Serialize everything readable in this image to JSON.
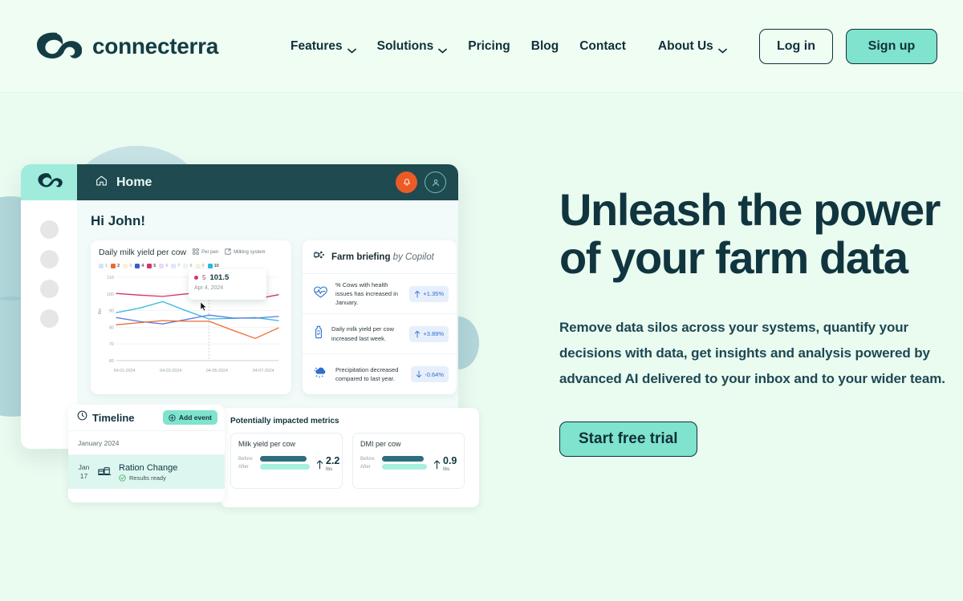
{
  "navbar": {
    "brand": "connecterra",
    "logo_icon": "connecterra-cloud-logo",
    "links": [
      {
        "label": "Features",
        "has_chevron": true
      },
      {
        "label": "Solutions",
        "has_chevron": true
      },
      {
        "label": "Pricing",
        "has_chevron": false
      },
      {
        "label": "Blog",
        "has_chevron": false
      },
      {
        "label": "Contact",
        "has_chevron": false
      },
      {
        "label": "About Us",
        "has_chevron": true
      }
    ],
    "login_label": "Log in",
    "signup_label": "Sign up"
  },
  "hero": {
    "heading_line1": "Unleash the power",
    "heading_line2": "of your farm data",
    "body": "Remove data silos across your systems, quantify your decisions with data, get insights and analysis powered by advanced AI delivered to your inbox and to your wider team.",
    "cta_label": "Start free trial"
  },
  "app": {
    "logo_icon": "connecterra-mark",
    "home_label": "Home",
    "home_icon": "home-icon",
    "bell_icon": "bell-icon",
    "avatar_icon": "user-avatar-icon",
    "greeting": "Hi John!",
    "sidebar_dots": 4
  },
  "chart_card": {
    "title": "Daily milk yield per cow",
    "tools": [
      {
        "label": "Per pen",
        "icon": "grid-icon"
      },
      {
        "label": "Milking system",
        "icon": "export-icon"
      }
    ],
    "tooltip": {
      "series": "5",
      "value": "101.5",
      "date": "Apr 4, 2024"
    }
  },
  "chart_data": {
    "type": "line",
    "title": "Daily milk yield per cow",
    "xlabel": "",
    "ylabel": "lbs",
    "ylim": [
      60,
      110
    ],
    "yticks": [
      60,
      70,
      80,
      90,
      100,
      110
    ],
    "x": [
      "04-01-2024",
      "04-02-2024",
      "04-03-2024",
      "04-04-2024",
      "04-05-2024",
      "04-06-2024",
      "04-07-2024",
      "04-08-2024"
    ],
    "xtick_labels": [
      "04-01-2024",
      "04-03-2024",
      "04-05-2024",
      "04-07-2024"
    ],
    "grid": true,
    "legend_position": "top",
    "legend": [
      {
        "label": "1",
        "color": "#a8c2f0",
        "active": false
      },
      {
        "label": "2",
        "color": "#ee6b2d",
        "active": true
      },
      {
        "label": "3",
        "color": "#f0e2a0",
        "active": false
      },
      {
        "label": "4",
        "color": "#3b5bd6",
        "active": true
      },
      {
        "label": "5",
        "color": "#d6336c",
        "active": true
      },
      {
        "label": "6",
        "color": "#c3b6f5",
        "active": false
      },
      {
        "label": "7",
        "color": "#b7cdf2",
        "active": false
      },
      {
        "label": "8",
        "color": "#c9ece3",
        "active": false
      },
      {
        "label": "9",
        "color": "#eae7b4",
        "active": false
      },
      {
        "label": "10",
        "color": "#2fb8e0",
        "active": true
      }
    ],
    "series": [
      {
        "name": "5",
        "color": "#d6336c",
        "values": [
          100.3,
          99.3,
          98.5,
          100.0,
          101.5,
          99.4,
          96.9,
          99.5
        ]
      },
      {
        "name": "10",
        "color": "#2fb8e0",
        "values": [
          88.8,
          91.5,
          95.4,
          90.0,
          85.0,
          85.3,
          85.8,
          84.0
        ]
      },
      {
        "name": "4",
        "color": "#5b7be0",
        "values": [
          85.8,
          83.5,
          82.0,
          84.6,
          87.3,
          85.6,
          85.5,
          86.5
        ]
      },
      {
        "name": "2",
        "color": "#ee6b2d",
        "values": [
          81.5,
          82.8,
          84.0,
          83.6,
          83.6,
          78.3,
          73.3,
          79.6
        ]
      }
    ],
    "highlight_x_index": 4
  },
  "briefing": {
    "title": "Farm briefing",
    "by": " by Copilot",
    "icon": "copilot-icon",
    "rows": [
      {
        "icon": "heartbeat-icon",
        "text": "% Cows with health issues has increased in January.",
        "delta": "+1.35%",
        "direction": "up"
      },
      {
        "icon": "milk-bottle-icon",
        "text": "Daily milk yield per cow increased last week.",
        "delta": "+3.89%",
        "direction": "up"
      },
      {
        "icon": "rain-cloud-icon",
        "text": "Precipitation decreased compared to last year.",
        "delta": "-0.64%",
        "direction": "down"
      }
    ]
  },
  "timeline": {
    "title": "Timeline",
    "clock_icon": "clock-icon",
    "add_event_label": "Add event",
    "add_icon": "plus-circle-icon",
    "month": "January 2024",
    "event": {
      "day_month": "Jan",
      "day_num": "17",
      "icon": "feed-ration-icon",
      "name": "Ration Change",
      "status": "Results ready",
      "status_icon": "check-circle-icon"
    }
  },
  "metrics": {
    "title": "Potentially impacted metrics",
    "items": [
      {
        "name": "Milk yield per cow",
        "before_label": "Before",
        "after_label": "After",
        "before_width": 58,
        "after_width": 62,
        "delta": "2.2",
        "unit": "lbs",
        "direction": "up"
      },
      {
        "name": "DMI per cow",
        "before_label": "Before",
        "after_label": "After",
        "before_width": 52,
        "after_width": 56,
        "delta": "0.9",
        "unit": "lbs",
        "direction": "up"
      }
    ]
  },
  "colors": {
    "page_bg": "#eafbf0",
    "nav_bg": "#effdf3",
    "brand_dark": "#143c44",
    "accent_mint": "#7fe3cd",
    "app_topbar": "#1e4a50",
    "bell_orange": "#ec5b26"
  }
}
